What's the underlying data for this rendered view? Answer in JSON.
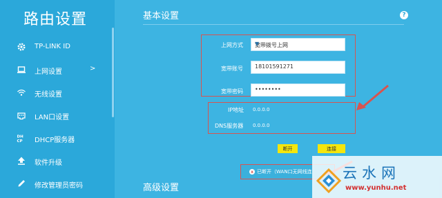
{
  "sidebar": {
    "title": "路由设置",
    "items": [
      {
        "label": "TP-LINK ID",
        "icon": "gear-icon"
      },
      {
        "label": "上网设置",
        "icon": "laptop-icon",
        "arrow": ">"
      },
      {
        "label": "无线设置",
        "icon": "wifi-icon"
      },
      {
        "label": "LAN口设置",
        "icon": "lan-port-icon"
      },
      {
        "label": "DHCP服务器",
        "icon": "dhcp-icon"
      },
      {
        "label": "软件升级",
        "icon": "upgrade-icon"
      },
      {
        "label": "修改管理员密码",
        "icon": "pencil-icon"
      }
    ]
  },
  "main": {
    "basic_title": "基本设置",
    "help": "?",
    "advanced_title": "高级设置",
    "form": {
      "mode_label": "上网方式",
      "mode_value": "宽带拨号上网",
      "account_label": "宽带账号",
      "account_value": "18101591271",
      "password_label": "宽带密码",
      "password_value": "••••••••"
    },
    "info": {
      "ip_label": "IP地址",
      "ip_value": "0.0.0.0",
      "dns_label": "DNS服务器",
      "dns_value": "0.0.0.0"
    },
    "buttons": {
      "disconnect": "断开",
      "connect": "连接"
    },
    "status": {
      "icon": "x",
      "text": "已断开（WAN口无网线连"
    }
  },
  "watermark": {
    "title": "云水网",
    "url": "www.yunhu.net"
  },
  "colors": {
    "sidebar_bg": "#2ba8da",
    "main_bg": "#3db4e2",
    "highlight_red": "#d9534f",
    "button_yellow": "#f5e60c",
    "watermark_blue": "#1a73b8",
    "watermark_red": "#d32f2f"
  }
}
